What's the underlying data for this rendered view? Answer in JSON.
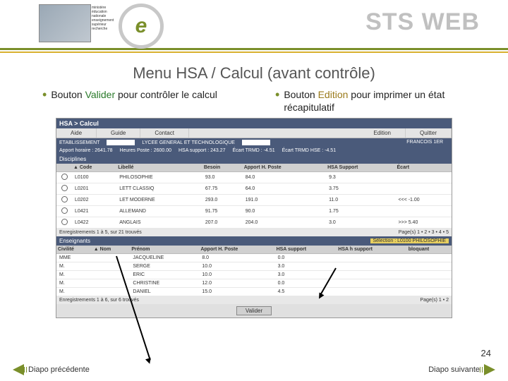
{
  "header": {
    "ministry": "ministère éducation nationale enseignement supérieur recherche",
    "product": "STS WEB"
  },
  "slide_title": "Menu HSA / Calcul (avant contrôle)",
  "bullets": {
    "left": {
      "pre": "Bouton ",
      "kw": "Valider",
      "post": " pour contrôler le calcul"
    },
    "right": {
      "pre": "Bouton ",
      "kw": "Edition",
      "post": " pour imprimer un état récapitulatif"
    }
  },
  "app": {
    "title": "HSA > Calcul",
    "menu": [
      "Aide",
      "Guide",
      "Contact",
      "Edition",
      "Quitter"
    ],
    "etab_bar": {
      "label": "ETABLISSEMENT",
      "type": "LYCEE GENERAL ET TECHNOLOGIQUE",
      "lib": "FRANCOIS 1ER"
    },
    "stats": [
      "Apport horaire : 2641.78",
      "Heures Poste : 2600.00",
      "HSA support : 243.27",
      "Écart TRMD : -4.51",
      "Écart TRMD HSE : -4.51"
    ],
    "disciplines": {
      "title": "Disciplines",
      "headers": [
        "",
        "▲ Code",
        "Libellé",
        "Besoin",
        "Apport H. Poste",
        "HSA Support",
        "Écart"
      ],
      "rows": [
        [
          "L0100",
          "PHILOSOPHIE",
          "93.0",
          "84.0",
          "9.3",
          ""
        ],
        [
          "L0201",
          "LETT CLASSIQ",
          "67.75",
          "64.0",
          "3.75",
          ""
        ],
        [
          "L0202",
          "LET MODERNE",
          "293.0",
          "191.0",
          "11.0",
          "<<< -1.00"
        ],
        [
          "L0421",
          "ALLEMAND",
          "91.75",
          "90.0",
          "1.75",
          ""
        ],
        [
          "L0422",
          "ANGLAIS",
          "207.0",
          "204.0",
          "3.0",
          ">>> 5.40"
        ]
      ],
      "footer_left": "Enregistrements 1 à 5, sur 21 trouvés",
      "footer_right": "Page(s) 1 • 2 • 3 • 4 • 5"
    },
    "enseignants": {
      "title": "Enseignants",
      "selection": "Sélection : L0100 PHILOSOPHIE",
      "headers": [
        "Civilité",
        "▲ Nom",
        "Prénom",
        "Apport H. Poste",
        "HSA support",
        "HSA h support",
        "bloquant"
      ],
      "rows": [
        [
          "MME",
          "",
          "JACQUELINE",
          "8.0",
          "0.0",
          "",
          ""
        ],
        [
          "M.",
          "",
          "SERGE",
          "10.0",
          "3.0",
          "",
          ""
        ],
        [
          "M.",
          "",
          "ERIC",
          "10.0",
          "3.0",
          "",
          ""
        ],
        [
          "M.",
          "",
          "CHRISTINE",
          "12.0",
          "0.0",
          "",
          ""
        ],
        [
          "M.",
          "",
          "DANIEL",
          "15.0",
          "4.5",
          "",
          ""
        ]
      ],
      "footer_left": "Enregistrements 1 à 6, sur 6 trouvés",
      "footer_right": "Page(s) 1 • 2"
    },
    "valider": "Valider"
  },
  "nav": {
    "prev": "Diapo précédente",
    "next": "Diapo suivante"
  },
  "page_number": "24"
}
